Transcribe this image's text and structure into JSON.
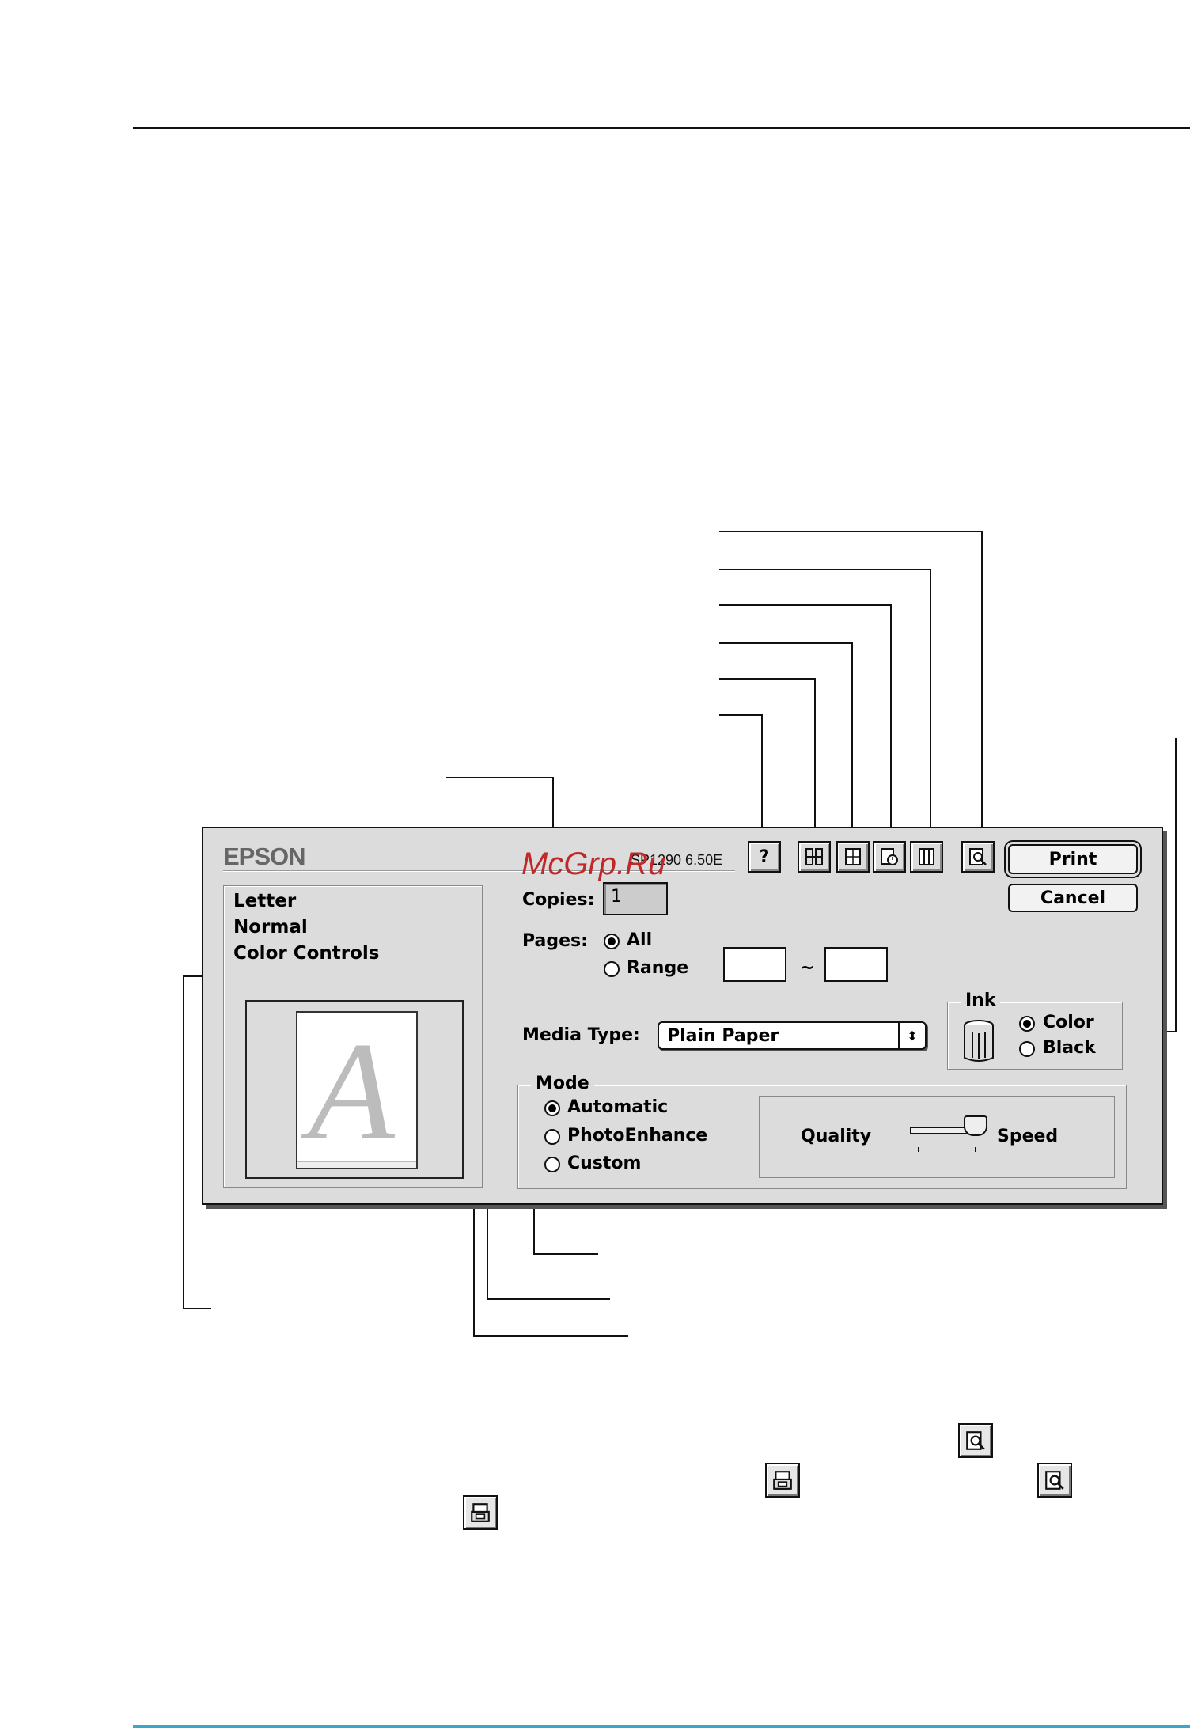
{
  "dialog": {
    "brand": "EPSON",
    "version": "SP1290 6.50E",
    "watermark": "McGrp.Ru",
    "summary": [
      "Letter",
      "Normal",
      "Color Controls"
    ],
    "preview_letter": "A",
    "copies_label": "Copies:",
    "copies_value": "1",
    "pages_label": "Pages:",
    "pages_all": "All",
    "pages_range": "Range",
    "range_separator": "~",
    "media_type_label": "Media Type:",
    "media_type_value": "Plain Paper",
    "ink": {
      "title": "Ink",
      "color": "Color",
      "black": "Black",
      "selected": "Color"
    },
    "mode": {
      "title": "Mode",
      "options": [
        "Automatic",
        "PhotoEnhance",
        "Custom"
      ],
      "selected": "Automatic"
    },
    "slider": {
      "left_label": "Quality",
      "right_label": "Speed"
    },
    "print_button": "Print",
    "cancel_button": "Cancel",
    "toolbar_icons": [
      "help-icon",
      "utility-icon",
      "layout-icon",
      "background-print-icon",
      "print-options-icon",
      "preview-icon"
    ]
  },
  "inline_icons": [
    "preview-icon",
    "save-file-icon",
    "preview-icon",
    "save-file-icon"
  ]
}
